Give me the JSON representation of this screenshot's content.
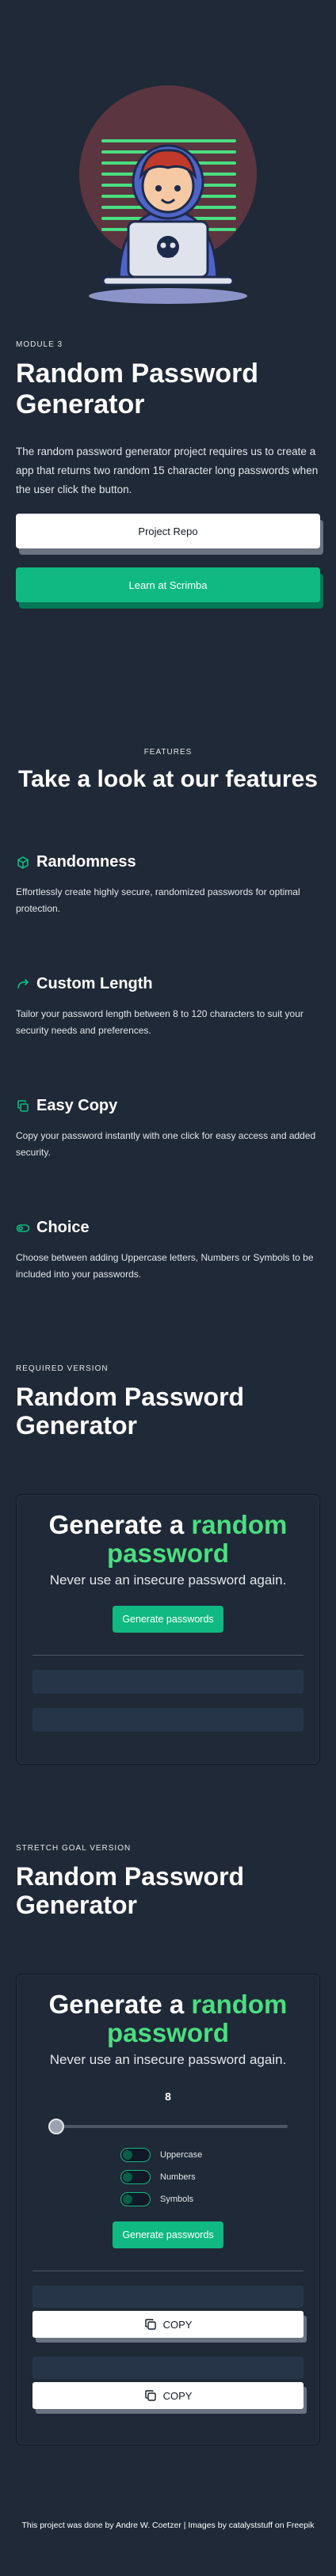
{
  "hero": {
    "illustration": "hacker-at-laptop-illustration"
  },
  "intro": {
    "module": "MODULE 3",
    "title": "Random Password Generator",
    "description": "The random password generator project requires us to create a app that returns two random 15 character long passwords when the user click the button.",
    "repo_button": "Project Repo",
    "scrimba_button": "Learn at Scrimba"
  },
  "features": {
    "eyebrow": "FEATURES",
    "heading": "Take a look at our features",
    "items": [
      {
        "icon": "cube-icon",
        "title": "Randomness",
        "text": "Effortlessly create highly secure, randomized passwords for optimal protection."
      },
      {
        "icon": "arrow-curve-icon",
        "title": "Custom Length",
        "text": "Tailor your password length between 8 to 120 characters to suit your security needs and preferences."
      },
      {
        "icon": "copy-icon",
        "title": "Easy Copy",
        "text": "Copy your password instantly with one click for easy access and added security."
      },
      {
        "icon": "toggle-icon",
        "title": "Choice",
        "text": "Choose between adding Uppercase letters, Numbers or Symbols to be included into your passwords."
      }
    ]
  },
  "required": {
    "eyebrow": "REQUIRED VERSION",
    "title": "Random Password Generator",
    "card": {
      "heading_part1": "Generate a ",
      "heading_accent": "random password",
      "subheading": "Never use an insecure password again.",
      "button": "Generate passwords"
    }
  },
  "stretch": {
    "eyebrow": "STRETCH GOAL VERSION",
    "title": "Random Password Generator",
    "card": {
      "heading_part1": "Generate a ",
      "heading_accent": "random password",
      "subheading": "Never use an insecure password again.",
      "length_value": "8",
      "slider_fraction": 0,
      "options": [
        "Uppercase",
        "Numbers",
        "Symbols"
      ],
      "button": "Generate passwords",
      "copy_label": "COPY"
    }
  },
  "footer": {
    "text": "This project was done by Andre W. Coetzer | Images by catalyststuff on Freepik"
  },
  "colors": {
    "background": "#1f2937",
    "accent_green": "#10b981",
    "heading_accent": "#4ade80"
  }
}
